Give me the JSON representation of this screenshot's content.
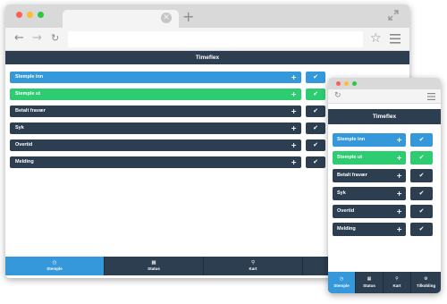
{
  "app_title": "Timeflex",
  "colors": {
    "dark": "#2c3e50",
    "blue": "#3498db",
    "green": "#2ecc71",
    "dot_red": "#ff5f57",
    "dot_yellow": "#febc2e",
    "dot_green": "#28c840"
  },
  "actions": [
    {
      "label": "Stemple inn",
      "color": "blue",
      "icon": "plus-icon"
    },
    {
      "label": "Stemple ut",
      "color": "green",
      "icon": "plus-icon"
    },
    {
      "label": "Betalt fravær",
      "color": "dark",
      "icon": "plus-icon"
    },
    {
      "label": "Syk",
      "color": "dark",
      "icon": "plus-icon"
    },
    {
      "label": "Overtid",
      "color": "dark",
      "icon": "plus-icon"
    },
    {
      "label": "Melding",
      "color": "dark",
      "icon": "plus-icon"
    }
  ],
  "check_glyph": "✔",
  "plus_glyph": "+",
  "footer_items": [
    {
      "label": "Stemple",
      "icon": "clock-icon",
      "glyph": "◷",
      "active": true
    },
    {
      "label": "Status",
      "icon": "calendar-icon",
      "glyph": "▦",
      "active": false
    },
    {
      "label": "Kart",
      "icon": "map-pin-icon",
      "glyph": "⚲",
      "active": false
    },
    {
      "label": "Tilkobling",
      "icon": "gear-icon",
      "glyph": "⚙",
      "active": false
    }
  ]
}
